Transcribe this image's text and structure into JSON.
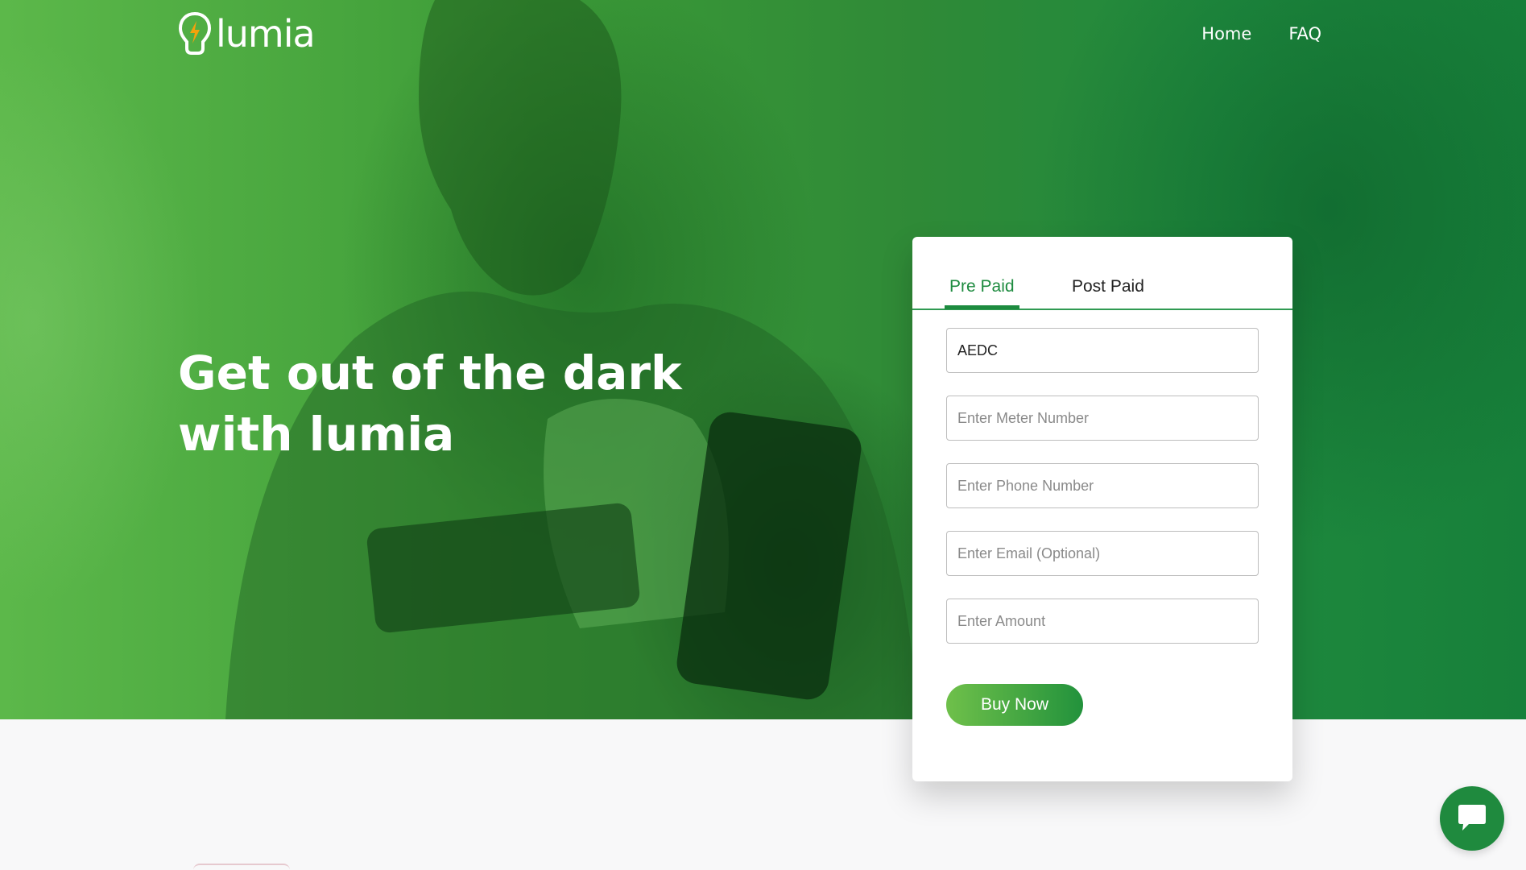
{
  "brand": {
    "name": "lumia",
    "logo_icon": "lightbulb-bolt-icon",
    "primary_color": "#1d8b3f",
    "accent_color": "#6fc04a"
  },
  "nav": {
    "items": [
      {
        "label": "Home"
      },
      {
        "label": "FAQ"
      }
    ]
  },
  "hero": {
    "headline_line1": "Get out of the dark",
    "headline_line2": "with lumia"
  },
  "purchase_form": {
    "tabs": [
      {
        "label": "Pre Paid",
        "active": true
      },
      {
        "label": "Post Paid",
        "active": false
      }
    ],
    "fields": {
      "provider": {
        "value": "AEDC"
      },
      "meter_number": {
        "placeholder": "Enter Meter Number"
      },
      "phone_number": {
        "placeholder": "Enter Phone Number"
      },
      "email": {
        "placeholder": "Enter Email (Optional)"
      },
      "amount": {
        "placeholder": "Enter Amount"
      }
    },
    "submit_label": "Buy Now"
  },
  "chat": {
    "icon": "chat-bubble-icon"
  }
}
